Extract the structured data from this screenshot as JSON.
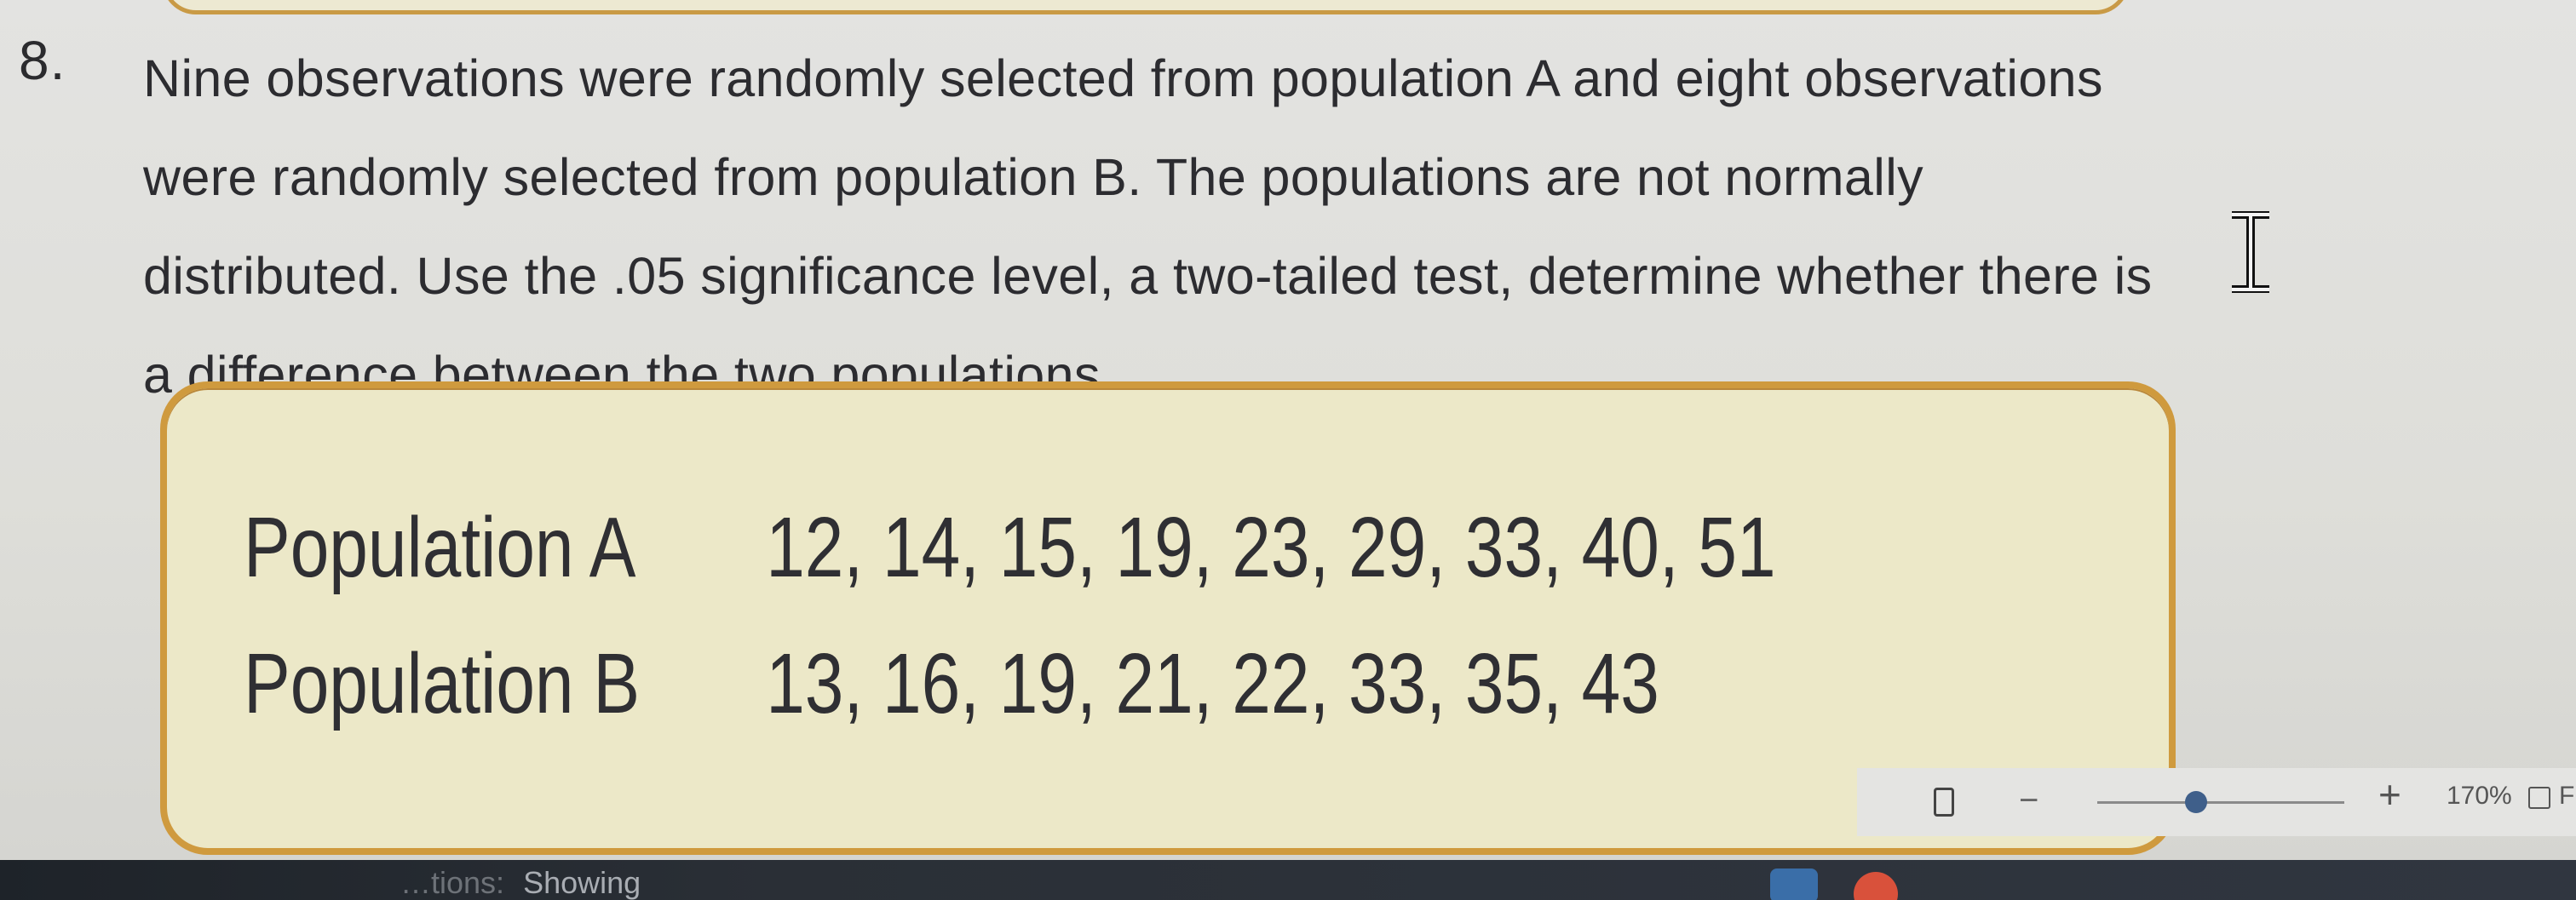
{
  "question": {
    "number": "8.",
    "lines": [
      "Nine observations were randomly selected from population A and eight observations",
      "were randomly selected from population B. The populations are not normally",
      "distributed. Use the .05 significance level, a two-tailed test, determine whether there is",
      "a difference between the two populations."
    ]
  },
  "table": {
    "rows": [
      {
        "label": "Population A",
        "values": "12, 14, 15, 19, 23, 29, 33, 40, 51"
      },
      {
        "label": "Population B",
        "values": "13, 16, 19, 21, 22, 33, 35, 43"
      }
    ],
    "card_fill": "#ece8c8",
    "card_border": "#cf9a3e"
  },
  "status_bar": {
    "zoom_out": "−",
    "zoom_in": "+",
    "zoom_level": "170%",
    "fit_label": "F",
    "zoom_fraction": 0.4
  },
  "bottom_bar": {
    "prefix": "…tions:",
    "text": "Showing"
  },
  "icons": {
    "caret": "text-cursor-icon",
    "page": "page-view-icon",
    "fit": "fit-width-icon"
  }
}
